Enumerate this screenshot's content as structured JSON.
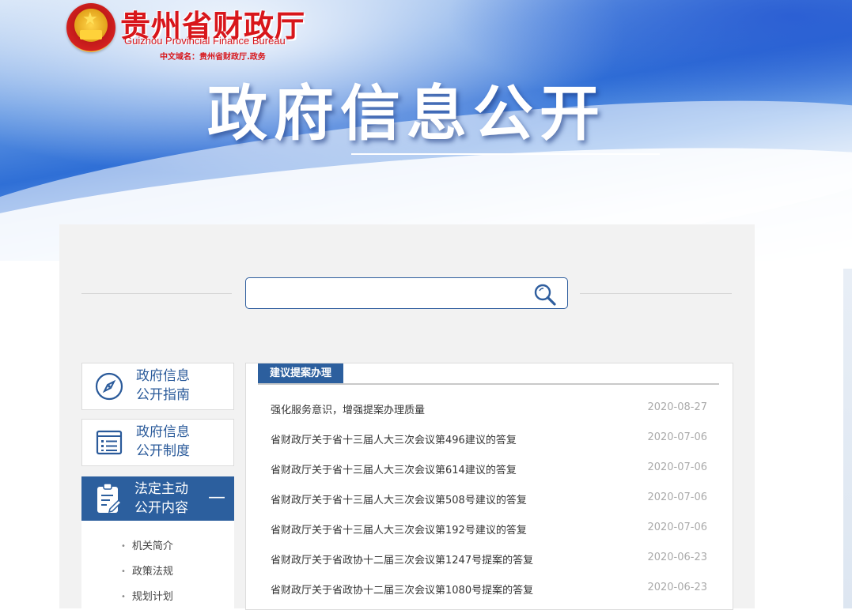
{
  "header": {
    "logo_cn": "贵州省财政厅",
    "logo_en": "Guizhou Provincial Finance Bureau",
    "domain_text": "中文域名：贵州省财政厅.政务",
    "page_title": "政府信息公开"
  },
  "search": {
    "value": "",
    "placeholder": ""
  },
  "sidebar": {
    "items": [
      {
        "label_line1": "政府信息",
        "label_line2": "公开指南",
        "icon": "compass-icon"
      },
      {
        "label_line1": "政府信息",
        "label_line2": "公开制度",
        "icon": "list-document-icon"
      },
      {
        "label_line1": "法定主动",
        "label_line2": "公开内容",
        "icon": "clipboard-edit-icon",
        "toggle": "—"
      }
    ],
    "sub_items": [
      "机关简介",
      "政策法规",
      "规划计划"
    ]
  },
  "content": {
    "tab_title": "建议提案办理",
    "rows": [
      {
        "title": "强化服务意识，增强提案办理质量",
        "date": "2020-08-27"
      },
      {
        "title": "省财政厅关于省十三届人大三次会议第496建议的答复",
        "date": "2020-07-06"
      },
      {
        "title": "省财政厅关于省十三届人大三次会议第614建议的答复",
        "date": "2020-07-06"
      },
      {
        "title": "省财政厅关于省十三届人大三次会议第508号建议的答复",
        "date": "2020-07-06"
      },
      {
        "title": "省财政厅关于省十三届人大三次会议第192号建议的答复",
        "date": "2020-07-06"
      },
      {
        "title": "省财政厅关于省政协十二届三次会议第1247号提案的答复",
        "date": "2020-06-23"
      },
      {
        "title": "省财政厅关于省政协十二届三次会议第1080号提案的答复",
        "date": "2020-06-23"
      }
    ]
  },
  "colors": {
    "brand_red": "#d8161b",
    "accent_blue": "#2c5f9e",
    "date_gray": "#aaaaaa"
  }
}
